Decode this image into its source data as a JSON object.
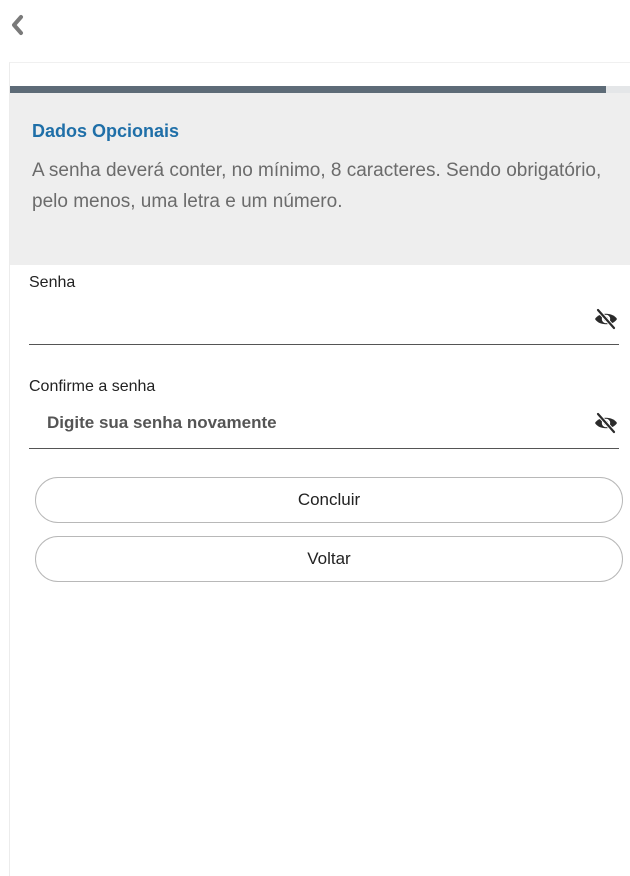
{
  "header": {
    "back_icon": "chevron-left-icon"
  },
  "progress": {
    "value_percent": 96,
    "color": "#5d6b77"
  },
  "info": {
    "title": "Dados Opcionais",
    "text": "A senha deverá conter, no mínimo, 8 caracteres. Sendo obrigatório, pelo menos, uma letra e um número.",
    "title_color": "#1f6fa8"
  },
  "form": {
    "password": {
      "label": "Senha",
      "value": "",
      "placeholder": "",
      "toggle_icon": "eye-slash-icon"
    },
    "confirm": {
      "label": "Confirme a senha",
      "value": "",
      "placeholder": "Digite sua senha novamente",
      "toggle_icon": "eye-slash-icon"
    }
  },
  "actions": {
    "submit_label": "Concluir",
    "back_label": "Voltar"
  }
}
